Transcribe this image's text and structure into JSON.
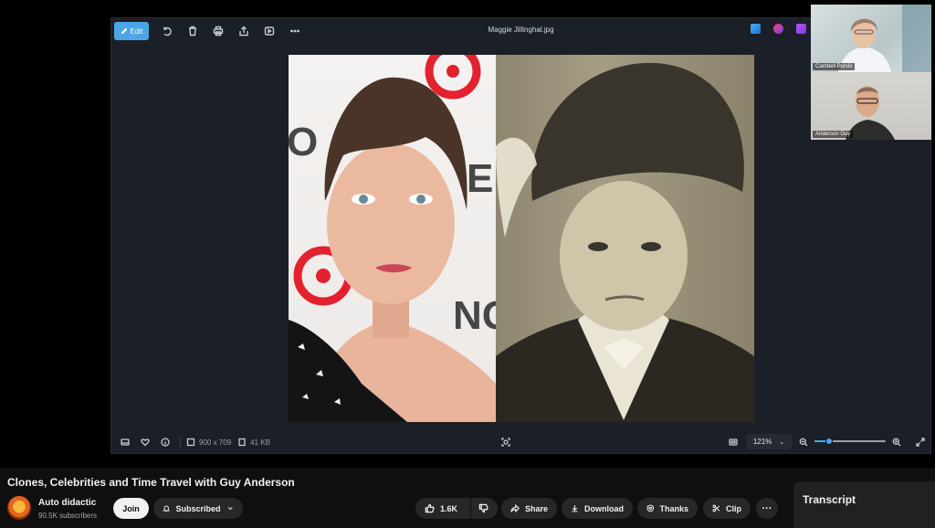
{
  "viewer": {
    "file_name": "Maggie Jillinghal.jpg",
    "edit_label": "Edit",
    "dimensions": "900 x 709",
    "file_size": "41 KB",
    "zoom": "121%",
    "zoom_level": 0.2
  },
  "webcams": [
    {
      "name": "Cambell Purvis"
    },
    {
      "name": "Anderson Guy"
    }
  ],
  "video": {
    "title": "Clones, Celebrities and Time Travel with Guy Anderson"
  },
  "channel": {
    "name": "Auto didactic",
    "subscribers": "90.5K subscribers",
    "join_label": "Join",
    "subscribed_label": "Subscribed"
  },
  "actions": {
    "likes": "1.6K",
    "share": "Share",
    "download": "Download",
    "thanks": "Thanks",
    "clip": "Clip",
    "more": "···"
  },
  "transcript": {
    "title": "Transcript"
  },
  "colors": {
    "accent": "#4aa6e6",
    "background": "#0f0f0f",
    "pill": "#272727"
  }
}
